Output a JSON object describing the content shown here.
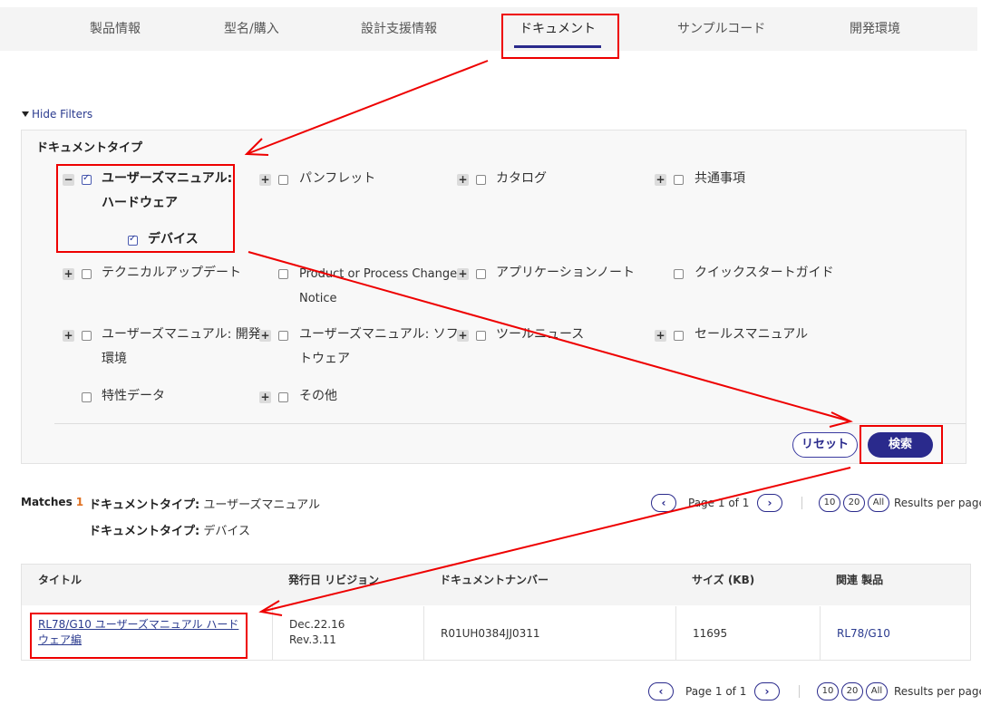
{
  "nav": {
    "tabs": [
      {
        "label": "製品情報"
      },
      {
        "label": "型名/購入"
      },
      {
        "label": "設計支援情報"
      },
      {
        "label": "ドキュメント"
      },
      {
        "label": "サンプルコード"
      },
      {
        "label": "開発環境"
      }
    ],
    "active_tab": "ドキュメント"
  },
  "filters": {
    "toggle_label": "Hide Filters",
    "group_title": "ドキュメントタイプ",
    "options": {
      "user_manual_hw": {
        "label_line1": "ユーザーズマニュアル:",
        "label_line2": "ハードウェア",
        "checked": true,
        "expander": "−"
      },
      "device": {
        "label": "デバイス",
        "checked": true
      },
      "pamphlet": {
        "label": "パンフレット",
        "checked": false,
        "expander": "+"
      },
      "catalog": {
        "label": "カタログ",
        "checked": false,
        "expander": "+"
      },
      "common": {
        "label": "共通事項",
        "checked": false,
        "expander": "+"
      },
      "technical_update": {
        "label": "テクニカルアップデート",
        "checked": false,
        "expander": "+"
      },
      "pcn": {
        "label_line1": "Product or Process Change",
        "label_line2": "Notice",
        "checked": false
      },
      "app_note": {
        "label": "アプリケーションノート",
        "checked": false,
        "expander": "+"
      },
      "quick_start": {
        "label": "クイックスタートガイド",
        "checked": false
      },
      "user_manual_dev": {
        "label_line1": "ユーザーズマニュアル: 開発",
        "label_line2": "環境",
        "checked": false,
        "expander": "+"
      },
      "user_manual_sw": {
        "label_line1": "ユーザーズマニュアル: ソフ",
        "label_line2": "トウェア",
        "checked": false,
        "expander": "+"
      },
      "tool_news": {
        "label": "ツールニュース",
        "checked": false,
        "expander": "+"
      },
      "sales_manual": {
        "label": "セールスマニュアル",
        "checked": false,
        "expander": "+"
      },
      "characteristics": {
        "label": "特性データ",
        "checked": false
      },
      "other": {
        "label": "その他",
        "checked": false,
        "expander": "+"
      }
    },
    "reset_label": "リセット",
    "search_label": "検索"
  },
  "results": {
    "matches_label": "Matches",
    "matches_count": "1",
    "criteria": [
      {
        "key": "ドキュメントタイプ:",
        "value": "ユーザーズマニュアル"
      },
      {
        "key": "ドキュメントタイプ:",
        "value": "デバイス"
      }
    ],
    "pager": {
      "prev": "‹",
      "next": "›",
      "page_text": "Page 1 of 1",
      "sizes": [
        "10",
        "20",
        "All"
      ],
      "per_page_label": "Results per page"
    },
    "table": {
      "headers": [
        "タイトル",
        "発行日 リビジョン",
        "ドキュメントナンバー",
        "サイズ (KB)",
        "関連 製品"
      ],
      "rows": [
        {
          "title_line1": "RL78/G10 ユーザーズマニュアル ハード",
          "title_line2": "ウェア編",
          "date": "Dec.22.16",
          "revision": "Rev.3.11",
          "doc_number": "R01UH0384JJ0311",
          "size": "11695",
          "related": "RL78/G10"
        }
      ]
    }
  },
  "annotation_color": "#e00000"
}
